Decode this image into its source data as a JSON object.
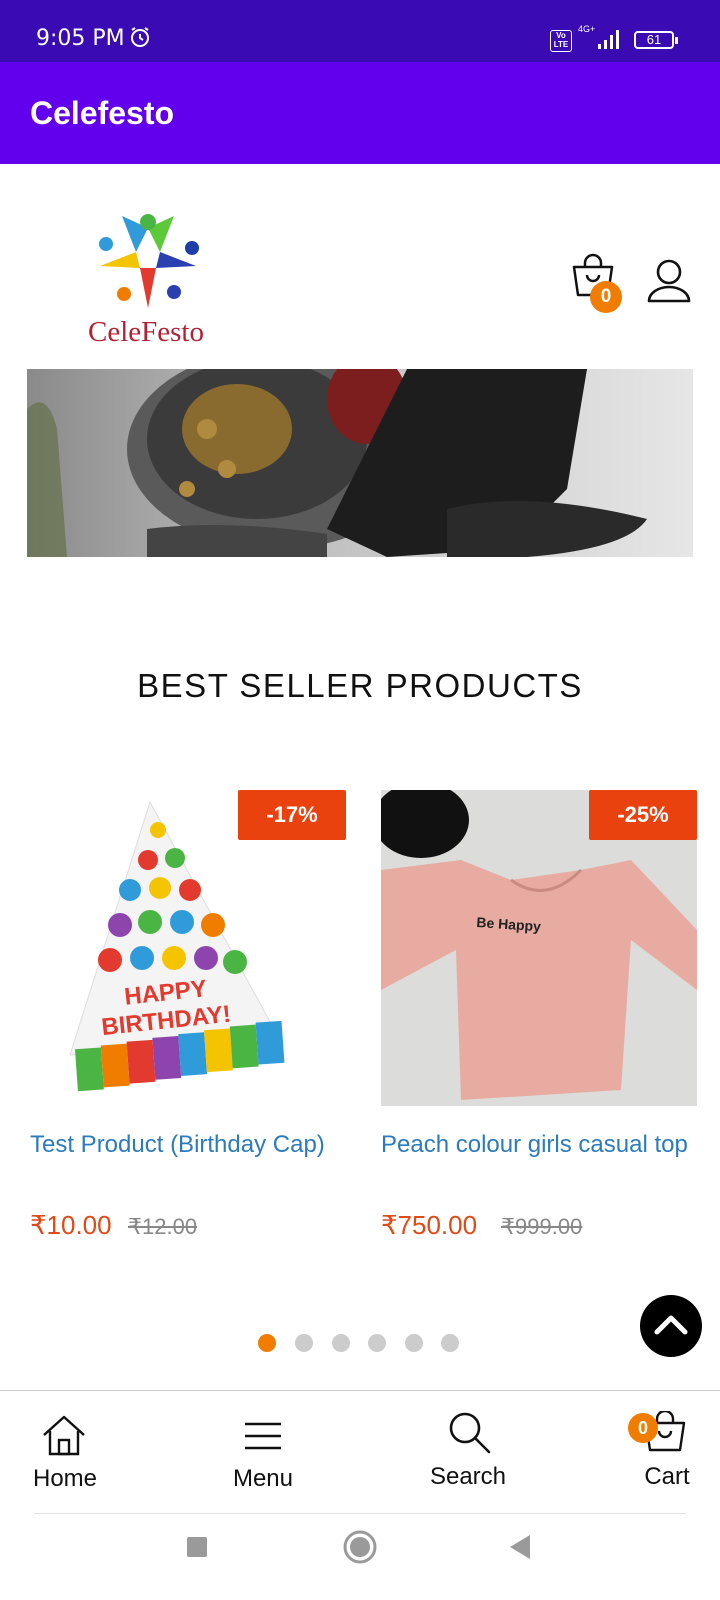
{
  "status_bar": {
    "time": "9:05 PM",
    "volte": "Vo LTE",
    "network": "4G+",
    "battery": "61"
  },
  "app_bar": {
    "title": "Celefesto"
  },
  "header": {
    "logo_text": "CeleFesto",
    "cart_count": "0"
  },
  "section": {
    "title": "BEST SELLER PRODUCTS"
  },
  "products": [
    {
      "discount": "-17%",
      "name": "Test Product (Birthday Cap)",
      "price": "₹10.00",
      "old_price": "₹12.00",
      "cap_text_1": "HAPPY",
      "cap_text_2": "BIRTHDAY!"
    },
    {
      "discount": "-25%",
      "name": "Peach colour girls casual top",
      "price": "₹750.00",
      "old_price": "₹999.00",
      "shirt_text": "Be Happy"
    }
  ],
  "carousel": {
    "pages": 6,
    "active": 0
  },
  "bottom_nav": [
    {
      "label": "Home",
      "icon": "home-icon"
    },
    {
      "label": "Menu",
      "icon": "menu-icon"
    },
    {
      "label": "Search",
      "icon": "search-icon"
    },
    {
      "label": "Cart",
      "icon": "cart-icon",
      "badge": "0"
    }
  ],
  "colors": {
    "status_bar": "#3a0ab3",
    "app_bar": "#6200ee",
    "accent": "#f07d00",
    "discount": "#e9420f",
    "link": "#2c7bbd",
    "price": "#e04a16"
  }
}
